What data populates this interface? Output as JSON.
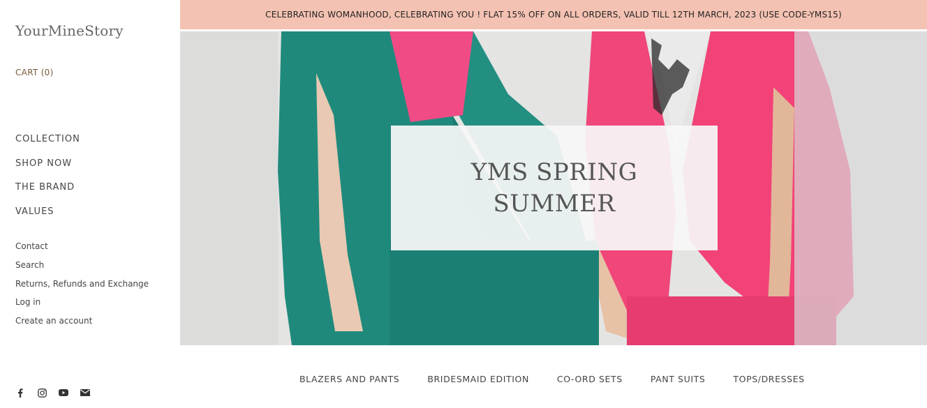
{
  "brand": {
    "logo_text": "YourMineStory"
  },
  "cart": {
    "label": "CART (0)"
  },
  "main_nav": [
    "COLLECTION",
    "SHOP NOW",
    "THE BRAND",
    "VALUES"
  ],
  "sub_nav": [
    "Contact",
    "Search",
    "Returns, Refunds and Exchange",
    "Log in",
    "Create an account"
  ],
  "social_icons": [
    "facebook-icon",
    "instagram-icon",
    "youtube-icon",
    "email-icon"
  ],
  "announcement": "CELEBRATING WOMANHOOD, CELEBRATING YOU ! FLAT 15% OFF ON ALL ORDERS, VALID TILL 12TH MARCH, 2023 (USE CODE-YMS15)",
  "hero": {
    "title": "YMS SPRING SUMMER"
  },
  "categories": [
    "BLAZERS AND PANTS",
    "BRIDESMAID EDITION",
    "CO-ORD SETS",
    "PANT SUITS",
    "TOPS/DRESSES"
  ],
  "colors": {
    "announcement_bg": "#f4c2b2",
    "green_cape": "#1f8a7c",
    "pink_cape": "#f0467a",
    "hero_bg": "#e3e3e3",
    "cart_text": "#7a5a3a"
  }
}
